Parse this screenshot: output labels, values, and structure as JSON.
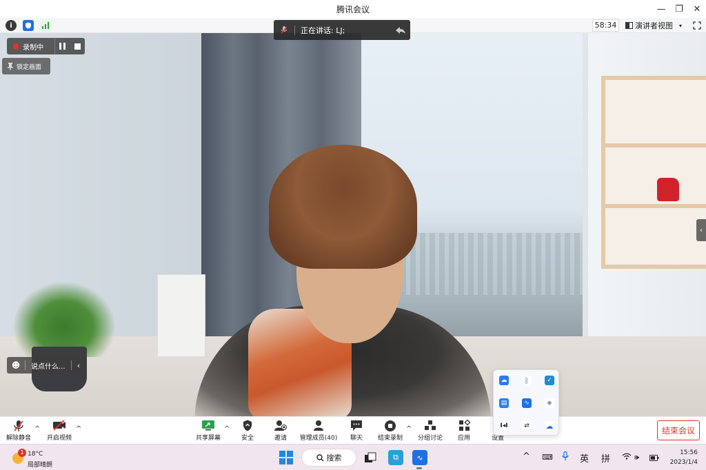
{
  "window": {
    "title": "腾讯会议",
    "controls": [
      "—",
      "❐",
      "✕"
    ]
  },
  "infobar": {
    "timer": "58:34",
    "view_label": "演讲者视图",
    "view_caret": "▾"
  },
  "overlays": {
    "recording_label": "录制中",
    "lock_view_label": "锁定画面",
    "speaking_label": "正在讲话: LJ;",
    "chat_placeholder": "说点什么...",
    "side_arrow": "‹"
  },
  "toolbar": {
    "unmute": "解除静音",
    "start_video": "开启视频",
    "share_screen": "共享屏幕",
    "security": "安全",
    "invite": "邀请",
    "manage_members": "管理成员(40)",
    "chat": "聊天",
    "end_recording": "结束录制",
    "breakout": "分组讨论",
    "apps": "应用",
    "settings": "设置",
    "end_meeting": "结束会议"
  },
  "taskbar": {
    "weather_badge": "1",
    "temperature": "18°C",
    "weather_desc": "局部晴朗",
    "search_label": "搜索",
    "ime_lang": "英",
    "ime_mode": "拼",
    "time": "15:56",
    "date": "2023/1/4"
  },
  "colors": {
    "accent_red": "#e5332a",
    "taskbar_bg": "#f1e6ee",
    "windows_blue": "#1e88e5"
  }
}
